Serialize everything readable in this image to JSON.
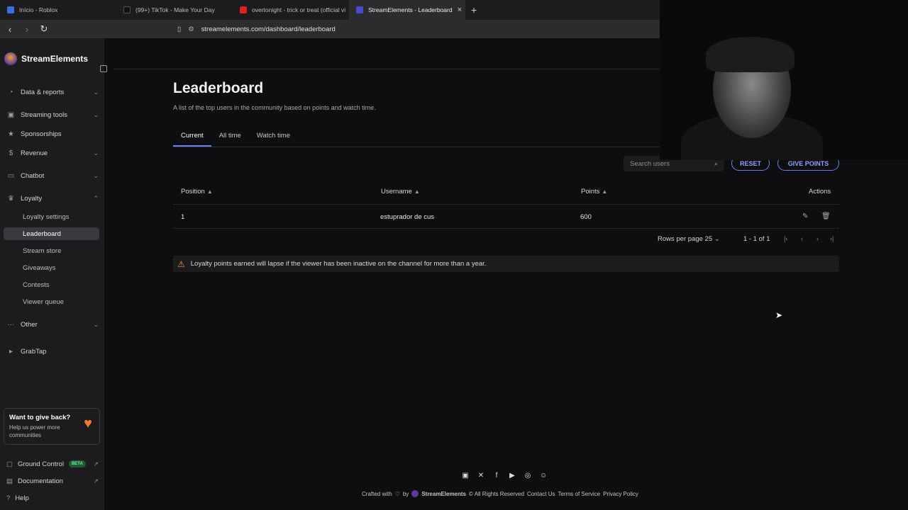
{
  "browser": {
    "tabs": [
      {
        "title": "Início - Roblox",
        "color": "#3b6fe0"
      },
      {
        "title": "(99+) TikTok - Make Your Day",
        "color": "#111111"
      },
      {
        "title": "overtonight - trick or treat (official vi",
        "color": "#e02020"
      },
      {
        "title": "StreamElements - Leaderboard",
        "color": "#2a2a60",
        "active": true
      }
    ],
    "close_tab": "×",
    "new_tab": "+",
    "url": "streamelements.com/dashboard/leaderboard"
  },
  "sidebar": {
    "brand": "StreamElements",
    "items": [
      {
        "label": "Data & reports",
        "icon": "chart-icon"
      },
      {
        "label": "Streaming tools",
        "icon": "tools-icon"
      },
      {
        "label": "Sponsorships",
        "icon": "star-icon"
      },
      {
        "label": "Revenue",
        "icon": "dollar-icon"
      },
      {
        "label": "Chatbot",
        "icon": "chat-icon"
      },
      {
        "label": "Loyalty",
        "icon": "trophy-icon"
      }
    ],
    "loyalty_sub": [
      "Loyalty settings",
      "Leaderboard",
      "Stream store",
      "Giveaways",
      "Contests",
      "Viewer queue"
    ],
    "other": "Other",
    "grabtap": "GrabTap",
    "promo": {
      "title": "Want to give back?",
      "text": "Help us power more communities"
    },
    "footer": {
      "ground_control": "Ground Control",
      "beta": "BETA",
      "documentation": "Documentation",
      "help": "Help"
    }
  },
  "page": {
    "title": "Leaderboard",
    "subtitle": "A list of the top users in the community based on points and watch time.",
    "tabs": [
      "Current",
      "All time",
      "Watch time"
    ],
    "search_placeholder": "Search users",
    "reset_label": "RESET",
    "give_points_label": "GIVE POINTS",
    "columns": [
      "Position",
      "Username",
      "Points",
      "Actions"
    ],
    "rows": [
      {
        "position": "1",
        "username": "estuprador de cus",
        "points": "600"
      }
    ],
    "rows_per_page_label": "Rows per page",
    "rows_per_page": "25",
    "range": "1 - 1 of 1",
    "notice": "Loyalty points earned will lapse if the viewer has been inactive on the channel for more than a year."
  },
  "footer": {
    "crafted": "Crafted with",
    "by": "by",
    "brand": "StreamElements",
    "rights": "© All Rights Reserved",
    "links": [
      "Contact Us",
      "Terms of Service",
      "Privacy Policy"
    ]
  }
}
